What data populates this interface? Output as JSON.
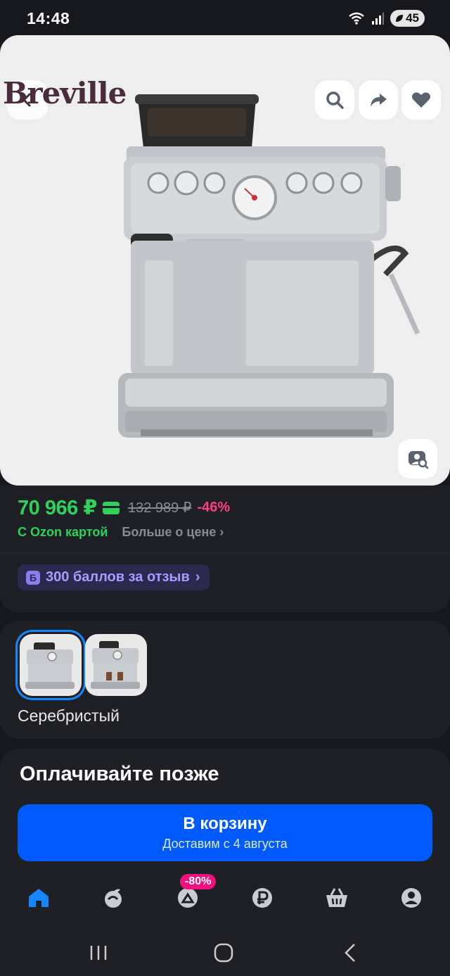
{
  "status": {
    "time": "14:48",
    "battery": "45"
  },
  "product": {
    "brand_logo": "Breville"
  },
  "price": {
    "current": "70 966 ₽",
    "old": "132 989 ₽",
    "discount": "-46%",
    "ozon_card": "С Ozon картой",
    "more_price": "Больше о цене",
    "bonus_letter": "Б",
    "bonus_text": "300 баллов за отзыв"
  },
  "variant": {
    "label": "Серебристый"
  },
  "purchase": {
    "pay_later": "Оплачивайте позже",
    "cart_label": "В корзину",
    "delivery": "Доставим с 4 августа"
  },
  "tabs": {
    "promo_badge": "-80%"
  },
  "colors": {
    "accent": "#005bff",
    "price_green": "#2fd15a",
    "discount_pink": "#ff3d7f",
    "badge_pink": "#f1117e",
    "selected_blue": "#1686ff"
  },
  "icons": [
    "search-icon",
    "share-icon",
    "heart-icon",
    "back-icon",
    "image-search-icon",
    "home-icon",
    "fresh-icon",
    "promo-icon",
    "finance-icon",
    "cart-icon",
    "profile-icon"
  ]
}
